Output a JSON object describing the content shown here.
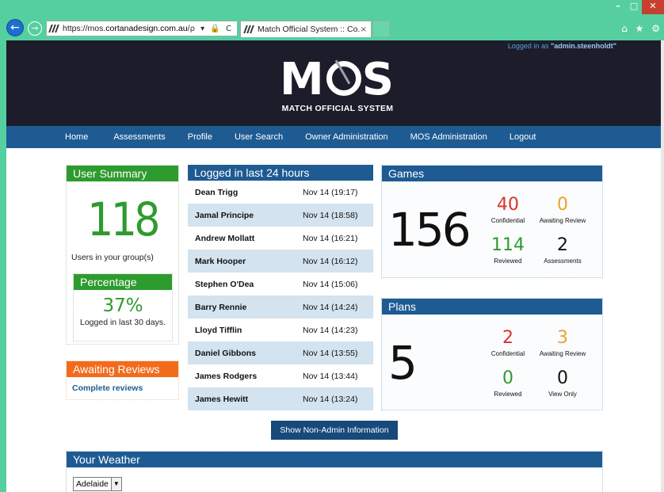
{
  "browser": {
    "url_prefix": "https://mos.",
    "url_domain": "cortanadesign.com.au",
    "url_suffix": "/",
    "tab_title": "Match Official System :: Co...",
    "tab_close": "×",
    "address_icons": "ρ ▾ 🔒 C",
    "window_controls": [
      "–",
      "□",
      "✕"
    ],
    "toolbar_icons": "⌂ ★ ⚙"
  },
  "header": {
    "logged_in_prefix": "Logged in as ",
    "logged_in_user": "\"admin.steenholdt\"",
    "logo_m": "M",
    "logo_s": "S",
    "logo_subtitle": "MATCH OFFICIAL SYSTEM"
  },
  "nav": [
    "Home",
    "Assessments",
    "Profile",
    "User Search",
    "Owner Administration",
    "MOS Administration",
    "Logout"
  ],
  "user_summary": {
    "title": "User Summary",
    "count": "118",
    "caption": "Users in your group(s)"
  },
  "percentage": {
    "title": "Percentage",
    "value": "37%",
    "caption": "Logged in last 30 days."
  },
  "awaiting_reviews": {
    "title": "Awaiting Reviews",
    "link": "Complete reviews"
  },
  "logged_24": {
    "title": "Logged in last 24 hours",
    "rows": [
      {
        "name": "Dean Trigg",
        "time": "Nov 14 (19:17)"
      },
      {
        "name": "Jamal Principe",
        "time": "Nov 14 (18:58)"
      },
      {
        "name": "Andrew Mollatt",
        "time": "Nov 14 (16:21)"
      },
      {
        "name": "Mark Hooper",
        "time": "Nov 14 (16:12)"
      },
      {
        "name": "Stephen O'Dea",
        "time": "Nov 14 (15:06)"
      },
      {
        "name": "Barry Rennie",
        "time": "Nov 14 (14:24)"
      },
      {
        "name": "Lloyd Tifflin",
        "time": "Nov 14 (14:23)"
      },
      {
        "name": "Daniel Gibbons",
        "time": "Nov 14 (13:55)"
      },
      {
        "name": "James Rodgers",
        "time": "Nov 14 (13:44)"
      },
      {
        "name": "James Hewitt",
        "time": "Nov 14 (13:24)"
      }
    ]
  },
  "games": {
    "title": "Games",
    "total": "156",
    "confidential": "40",
    "confidential_label": "Confidential",
    "awaiting": "0",
    "awaiting_label": "Awaiting Review",
    "reviewed": "114",
    "reviewed_label": "Reviewed",
    "assessments": "2",
    "assessments_label": "Assessments"
  },
  "plans": {
    "title": "Plans",
    "total": "5",
    "confidential": "2",
    "confidential_label": "Confidential",
    "awaiting": "3",
    "awaiting_label": "Awaiting Review",
    "reviewed": "0",
    "reviewed_label": "Reviewed",
    "view_only": "0",
    "view_only_label": "View Only"
  },
  "show_button": "Show Non-Admin Information",
  "weather": {
    "title": "Your Weather",
    "selected_city": "Adelaide",
    "select_arrow": "▼"
  },
  "colors": {
    "green": "#2e9b2e",
    "orange": "#f26b1d",
    "blue": "#1e5b93",
    "header_bg": "#1c1c2a",
    "chrome": "#56cfa0",
    "red": "#d9342b",
    "amber": "#f2a02b"
  }
}
